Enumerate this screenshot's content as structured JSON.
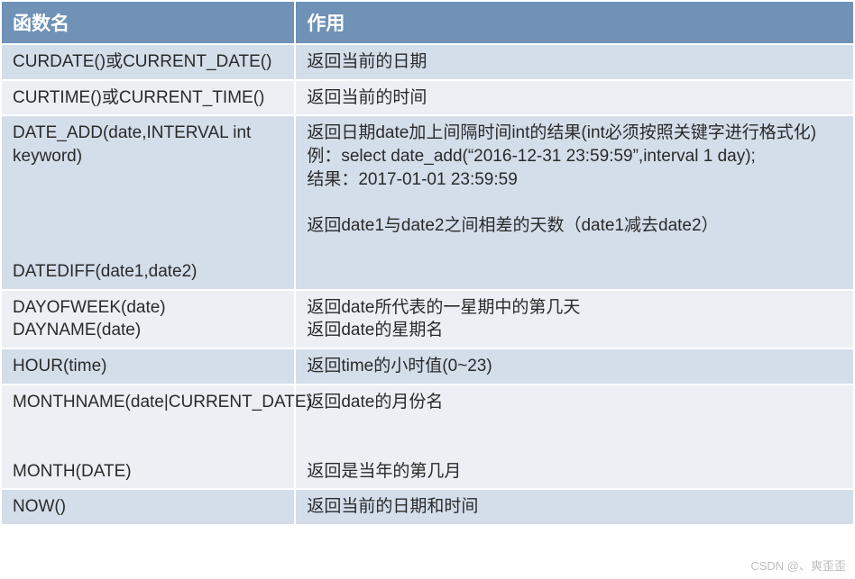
{
  "header": {
    "col1": "函数名",
    "col2": "作用"
  },
  "rows": [
    {
      "fn": "CURDATE()或CURRENT_DATE()",
      "desc": "返回当前的日期"
    },
    {
      "fn": "CURTIME()或CURRENT_TIME()",
      "desc": "返回当前的时间"
    },
    {
      "fn": "DATE_ADD(date,INTERVAL int keyword)\n\n\n\n\nDATEDIFF(date1,date2)",
      "desc": "返回日期date加上间隔时间int的结果(int必须按照关键字进行格式化)\n例：select date_add(“2016-12-31 23:59:59”,interval 1 day);\n结果：2017-01-01 23:59:59\n\n返回date1与date2之间相差的天数（date1减去date2）"
    },
    {
      "fn": "DAYOFWEEK(date) DAYNAME(date)",
      "desc": "返回date所代表的一星期中的第几天\n返回date的星期名"
    },
    {
      "fn": "HOUR(time)",
      "desc": "返回time的小时值(0~23)"
    },
    {
      "fn": "MONTHNAME(date|CURRENT_DATE)\n\n\nMONTH(DATE)",
      "desc": "返回date的月份名\n\n\n返回是当年的第几月"
    },
    {
      "fn": "NOW()",
      "desc": "返回当前的日期和时间"
    }
  ],
  "watermark": "CSDN @、爽歪歪"
}
